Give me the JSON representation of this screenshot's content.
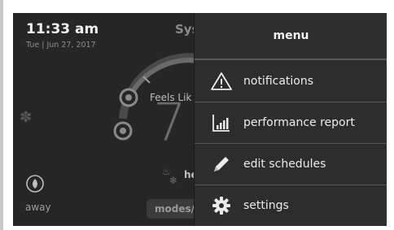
{
  "status": {
    "time": "11:33 am",
    "date": "Tue | Jun 27, 2017"
  },
  "home": {
    "system_label": "Sys",
    "feels_like_label": "Feels Lik",
    "temperature": "7",
    "mode_label": "he",
    "away_label": "away",
    "modes_button_label": "modes/"
  },
  "menu": {
    "title": "menu",
    "items": [
      {
        "label": "notifications",
        "icon": "warning-icon"
      },
      {
        "label": "performance report",
        "icon": "bar-chart-icon"
      },
      {
        "label": "edit schedules",
        "icon": "pencil-icon"
      },
      {
        "label": "settings",
        "icon": "gear-icon"
      }
    ]
  },
  "colors": {
    "screen_bg": "#262626",
    "menu_bg": "#2d2d2d",
    "text_primary": "#f2f2f2",
    "divider": "#555555"
  }
}
